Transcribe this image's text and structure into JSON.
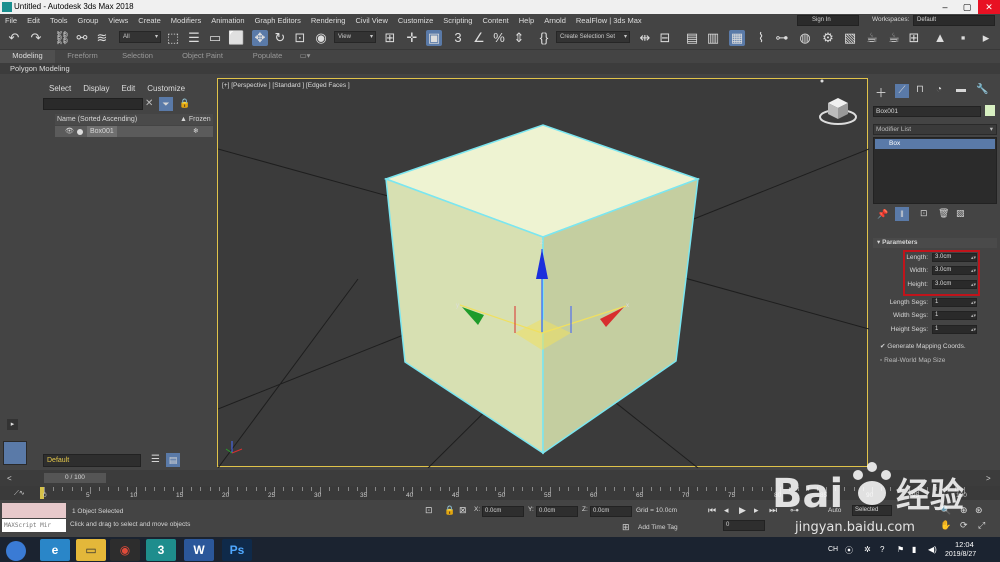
{
  "window": {
    "title": "Untitled - Autodesk 3ds Max 2018"
  },
  "menu": [
    "File",
    "Edit",
    "Tools",
    "Group",
    "Views",
    "Create",
    "Modifiers",
    "Animation",
    "Graph Editors",
    "Rendering",
    "Civil View",
    "Customize",
    "Scripting",
    "Content",
    "Help",
    "Arnold",
    "RealFlow | 3ds Max"
  ],
  "account": {
    "sign_in": "Sign In",
    "workspaces_label": "Workspaces:",
    "workspace": "Default"
  },
  "toolbar": {
    "selection_filter": "All",
    "ref_coord": "View",
    "named_selection": "Create Selection Set"
  },
  "ribbon": {
    "tabs": [
      "Modeling",
      "Freeform",
      "Selection",
      "Object Paint",
      "Populate"
    ],
    "active_tab": "Modeling",
    "sub": "Polygon Modeling"
  },
  "explorer": {
    "menu": [
      "Select",
      "Display",
      "Edit",
      "Customize"
    ],
    "col_name": "Name (Sorted Ascending)",
    "col_frozen": "▲ Frozen",
    "row": "Box001",
    "layer": "Default"
  },
  "viewport": {
    "label": "[+] [Perspective ] [Standard ] [Edged Faces ]"
  },
  "command_panel": {
    "object_name": "Box001",
    "modifier_list": "Modifier List",
    "stack_item": "Box",
    "rollout": "Parameters",
    "params": [
      {
        "label": "Length:",
        "value": "3.0cm"
      },
      {
        "label": "Width:",
        "value": "3.0cm"
      },
      {
        "label": "Height:",
        "value": "3.0cm"
      },
      {
        "label": "Length Segs:",
        "value": "1"
      },
      {
        "label": "Width Segs:",
        "value": "1"
      },
      {
        "label": "Height Segs:",
        "value": "1"
      }
    ],
    "gen_mapping": "Generate Mapping Coords.",
    "real_world": "Real-World Map Size"
  },
  "timeline": {
    "frame": "0 / 100",
    "ticks": [
      "0",
      "5",
      "10",
      "15",
      "20",
      "25",
      "30",
      "35",
      "40",
      "45",
      "50",
      "55",
      "60",
      "65",
      "70",
      "75",
      "80",
      "85",
      "90",
      "95",
      "100"
    ]
  },
  "status": {
    "maxscript": "MAXScript Mir",
    "selected": "1 Object Selected",
    "message": "Click and drag to select and move objects",
    "x_label": "X:",
    "x_value": "0.0cm",
    "y_label": "Y:",
    "y_value": "0.0cm",
    "z_label": "Z:",
    "z_value": "0.0cm",
    "grid": "Grid = 10.0cm",
    "add_time_tag": "Add Time Tag",
    "auto": "Auto",
    "selected_btn": "Selected",
    "frame_field": "0"
  },
  "taskbar": {
    "lang": "CH",
    "time": "12:04",
    "date": "2019/8/27"
  },
  "watermark": {
    "site": "jingyan.baidu.com"
  }
}
